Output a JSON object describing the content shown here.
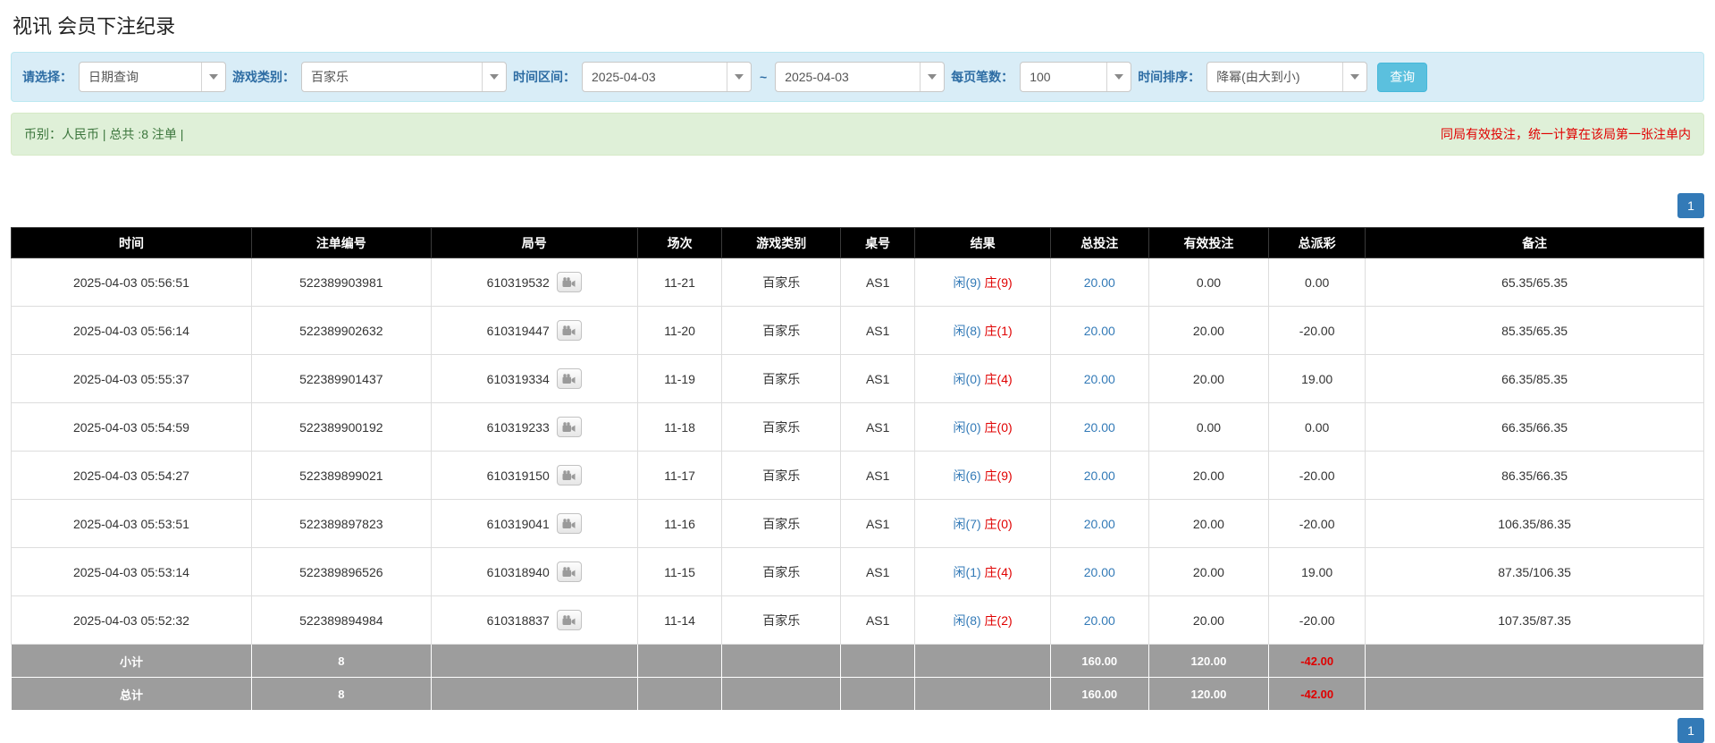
{
  "page": {
    "title": "视讯 会员下注纪录"
  },
  "colors": {
    "header_bg": "#000000",
    "accent_blue": "#337ab7",
    "red": "#e00000",
    "filter_bg": "#d9edf7",
    "info_bg": "#dff0d8",
    "footer_bg": "#9d9d9d",
    "search_button_bg": "#5bc0de"
  },
  "icons": {
    "dropdown_caret": "chevron-down-icon",
    "round_replay": "video-replay-icon"
  },
  "filters": {
    "select_label": "请选择：",
    "select_value": "日期查询",
    "game_type_label": "游戏类别：",
    "game_type_value": "百家乐",
    "time_range_label": "时间区间：",
    "date_from": "2025-04-03",
    "range_separator": "~",
    "date_to": "2025-04-03",
    "page_size_label": "每页笔数：",
    "page_size_value": "100",
    "time_sort_label": "时间排序：",
    "time_sort_value": "降幂(由大到小)",
    "search_button_label": "查询"
  },
  "info_bar": {
    "summary": "币别：人民币 | 总共 :8 注单 |",
    "notice": "同局有效投注，统一计算在该局第一张注单内"
  },
  "pagination": {
    "page_label": "1"
  },
  "table": {
    "headers": [
      "时间",
      "注单编号",
      "局号",
      "场次",
      "游戏类别",
      "桌号",
      "结果",
      "总投注",
      "有效投注",
      "总派彩",
      "备注"
    ],
    "rows": [
      {
        "time": "2025-04-03 05:56:51",
        "bet_id": "522389903981",
        "round_id": "610319532",
        "session": "11-21",
        "game_type": "百家乐",
        "table_no": "AS1",
        "result_player": "闲(9)",
        "result_banker": "庄(9)",
        "total_bet": "20.00",
        "valid_bet": "0.00",
        "payout": "0.00",
        "remark": "65.35/65.35"
      },
      {
        "time": "2025-04-03 05:56:14",
        "bet_id": "522389902632",
        "round_id": "610319447",
        "session": "11-20",
        "game_type": "百家乐",
        "table_no": "AS1",
        "result_player": "闲(8)",
        "result_banker": "庄(1)",
        "total_bet": "20.00",
        "valid_bet": "20.00",
        "payout": "-20.00",
        "remark": "85.35/65.35"
      },
      {
        "time": "2025-04-03 05:55:37",
        "bet_id": "522389901437",
        "round_id": "610319334",
        "session": "11-19",
        "game_type": "百家乐",
        "table_no": "AS1",
        "result_player": "闲(0)",
        "result_banker": "庄(4)",
        "total_bet": "20.00",
        "valid_bet": "20.00",
        "payout": "19.00",
        "remark": "66.35/85.35"
      },
      {
        "time": "2025-04-03 05:54:59",
        "bet_id": "522389900192",
        "round_id": "610319233",
        "session": "11-18",
        "game_type": "百家乐",
        "table_no": "AS1",
        "result_player": "闲(0)",
        "result_banker": "庄(0)",
        "total_bet": "20.00",
        "valid_bet": "0.00",
        "payout": "0.00",
        "remark": "66.35/66.35"
      },
      {
        "time": "2025-04-03 05:54:27",
        "bet_id": "522389899021",
        "round_id": "610319150",
        "session": "11-17",
        "game_type": "百家乐",
        "table_no": "AS1",
        "result_player": "闲(6)",
        "result_banker": "庄(9)",
        "total_bet": "20.00",
        "valid_bet": "20.00",
        "payout": "-20.00",
        "remark": "86.35/66.35"
      },
      {
        "time": "2025-04-03 05:53:51",
        "bet_id": "522389897823",
        "round_id": "610319041",
        "session": "11-16",
        "game_type": "百家乐",
        "table_no": "AS1",
        "result_player": "闲(7)",
        "result_banker": "庄(0)",
        "total_bet": "20.00",
        "valid_bet": "20.00",
        "payout": "-20.00",
        "remark": "106.35/86.35"
      },
      {
        "time": "2025-04-03 05:53:14",
        "bet_id": "522389896526",
        "round_id": "610318940",
        "session": "11-15",
        "game_type": "百家乐",
        "table_no": "AS1",
        "result_player": "闲(1)",
        "result_banker": "庄(4)",
        "total_bet": "20.00",
        "valid_bet": "20.00",
        "payout": "19.00",
        "remark": "87.35/106.35"
      },
      {
        "time": "2025-04-03 05:52:32",
        "bet_id": "522389894984",
        "round_id": "610318837",
        "session": "11-14",
        "game_type": "百家乐",
        "table_no": "AS1",
        "result_player": "闲(8)",
        "result_banker": "庄(2)",
        "total_bet": "20.00",
        "valid_bet": "20.00",
        "payout": "-20.00",
        "remark": "107.35/87.35"
      }
    ],
    "subtotal": {
      "label": "小计",
      "count": "8",
      "total_bet": "160.00",
      "valid_bet": "120.00",
      "payout": "-42.00"
    },
    "total": {
      "label": "总计",
      "count": "8",
      "total_bet": "160.00",
      "valid_bet": "120.00",
      "payout": "-42.00"
    }
  }
}
